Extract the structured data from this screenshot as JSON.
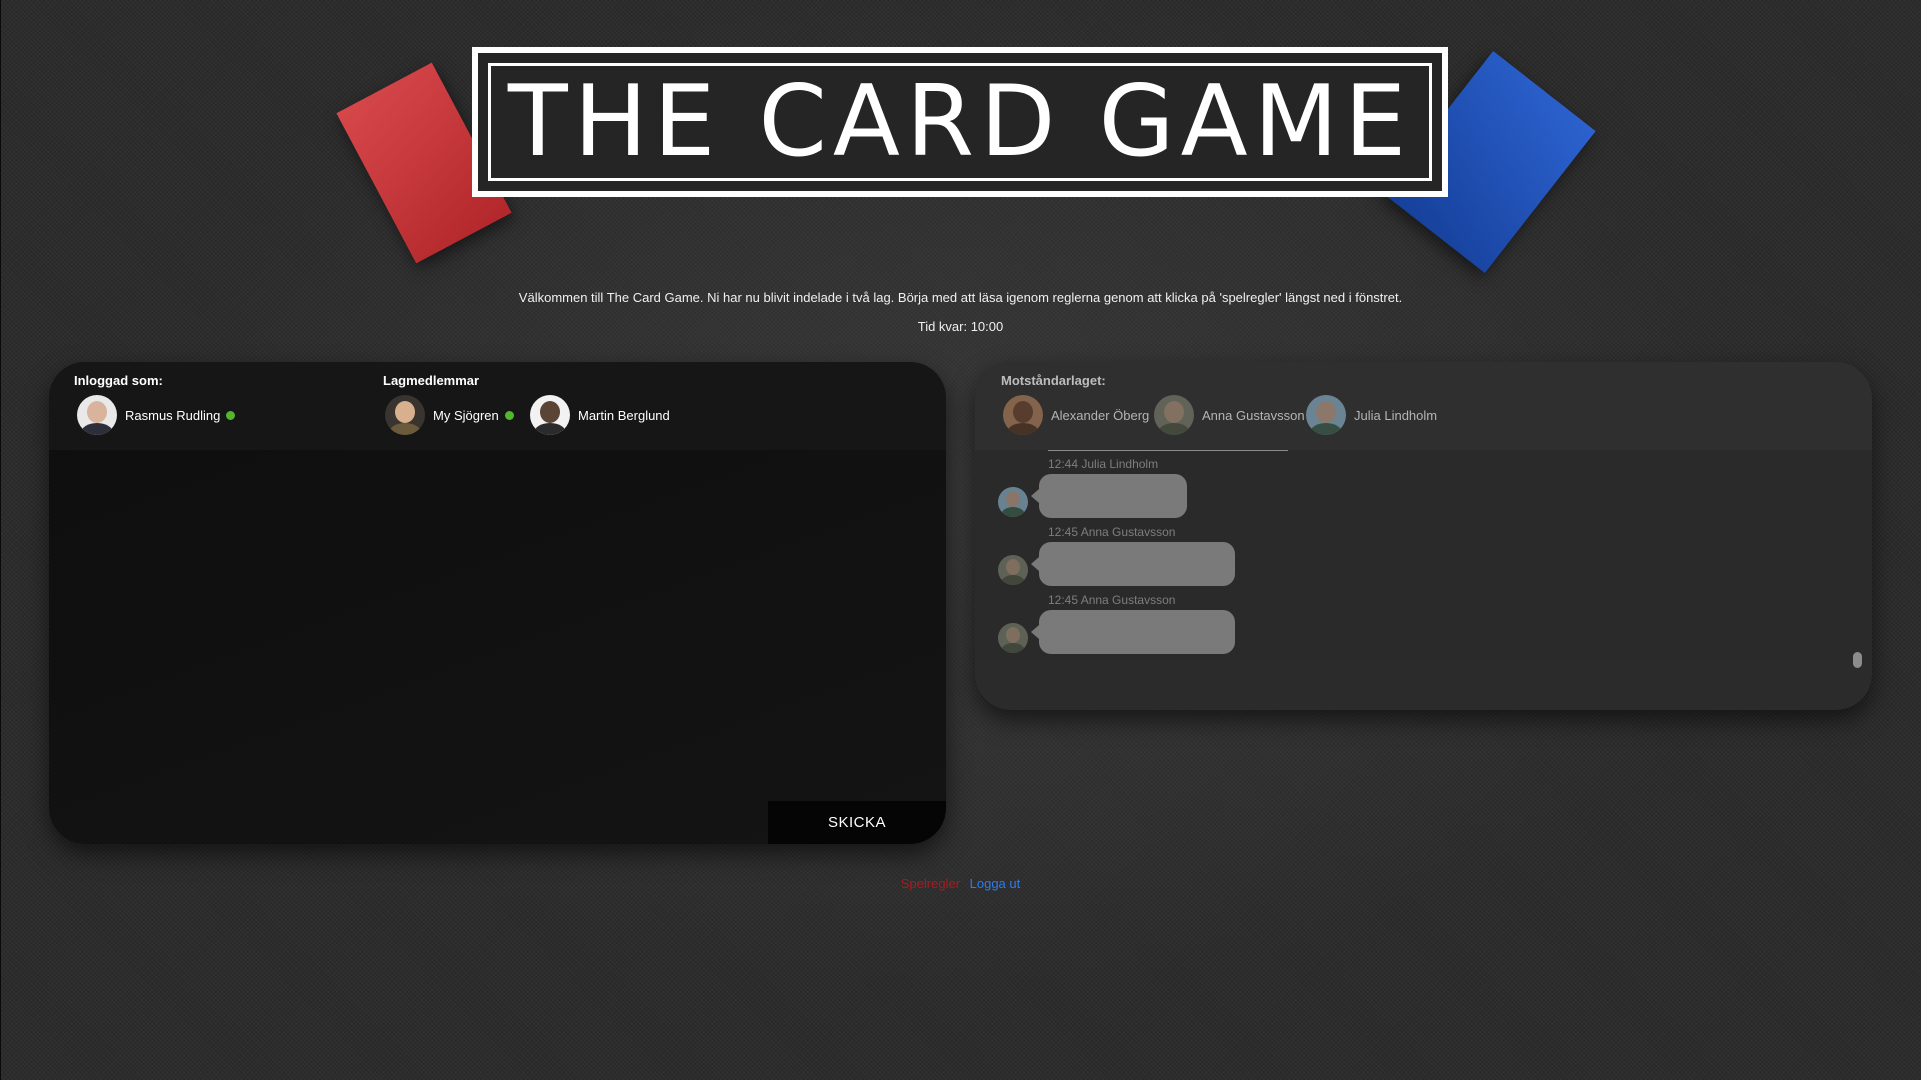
{
  "logo": {
    "title": "THE CARD GAME",
    "red_card_color": "#c0363a",
    "blue_card_color": "#1f4fb5"
  },
  "intro": {
    "welcome_text": "Välkommen till The Card Game. Ni har nu blivit indelade i två lag. Börja med att läsa igenom reglerna genom att klicka på 'spelregler' längst ned i fönstret.",
    "timer_text": "Tid kvar: 10:00"
  },
  "own_team_panel": {
    "logged_in_label": "Inloggad som:",
    "team_members_label": "Lagmedlemmar",
    "logged_in_user": {
      "name": "Rasmus Rudling",
      "online": true
    },
    "members": [
      {
        "name": "My Sjögren",
        "online": true
      },
      {
        "name": "Martin Berglund",
        "online": false
      }
    ],
    "send_label": "SKICKA",
    "online_color": "#52b72e"
  },
  "opponent_panel": {
    "label": "Motståndarlaget:",
    "members": [
      {
        "name": "Alexander Öberg"
      },
      {
        "name": "Anna Gustavsson"
      },
      {
        "name": "Julia Lindholm"
      }
    ],
    "messages": [
      {
        "meta": "12:44 Julia Lindholm"
      },
      {
        "meta": "12:45 Anna Gustavsson"
      },
      {
        "meta": "12:45 Anna Gustavsson"
      }
    ]
  },
  "footer": {
    "rules_link": "Spelregler",
    "logout_link": "Logga ut",
    "rules_color": "#a31e22",
    "logout_color": "#2d7bf0"
  }
}
